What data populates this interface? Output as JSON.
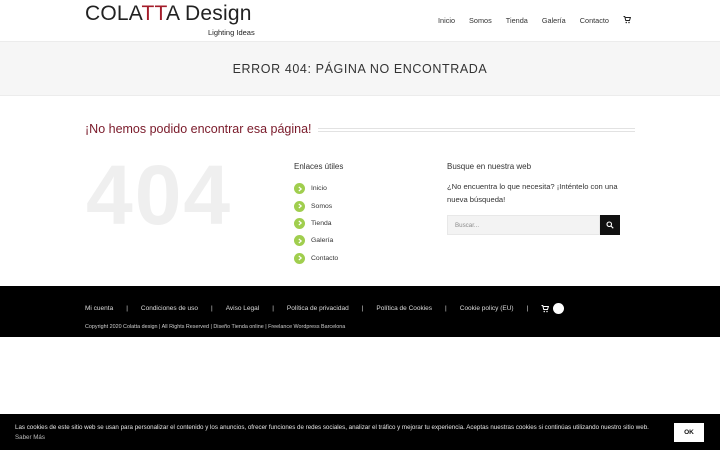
{
  "header": {
    "logo": {
      "part1": "COLA",
      "part2": "TT",
      "part3": "A Design",
      "tagline": "Lighting Ideas"
    },
    "nav": [
      "Inicio",
      "Somos",
      "Tienda",
      "Galería",
      "Contacto"
    ],
    "cart_icon": "shopping-cart-icon"
  },
  "page_title": "ERROR 404: PÁGINA NO ENCONTRADA",
  "main": {
    "heading": "¡No hemos podido encontrar esa página!",
    "big_code": "404",
    "useful_links": {
      "title": "Enlaces útiles",
      "items": [
        "Inicio",
        "Somos",
        "Tienda",
        "Galería",
        "Contacto"
      ],
      "bullet_icon": "chevron-right-icon",
      "bullet_color": "#a0ce4e"
    },
    "search": {
      "title": "Busque en nuestra web",
      "description": "¿No encuentra lo que necesita? ¡Inténtelo con una nueva búsqueda!",
      "placeholder": "Buscar...",
      "button_icon": "search-icon"
    }
  },
  "footer": {
    "links": [
      "Mi cuenta",
      "Condiciones de uso",
      "Aviso Legal",
      "Política de privacidad",
      "Política de Cookies",
      "Cookie policy (EU)"
    ],
    "separator": "|",
    "cart_icon": "shopping-cart-icon",
    "copyright": "Copyright 2020 Colatta design | All Rights Reserved | Diseño Tienda online | Freelance Wordpress Barcelona"
  },
  "cookie": {
    "text": "Las cookies de este sitio web se usan para personalizar el contenido y los anuncios, ofrecer funciones de redes sociales, analizar el tráfico y mejorar tu experiencia. Aceptas nuestras cookies si continúas utilizando nuestro sitio web.",
    "more_link": "Saber Más",
    "ok_label": "OK"
  },
  "colors": {
    "brand_red": "#a31c2a",
    "heading_maroon": "#7a1a2a",
    "accent_green": "#a0ce4e",
    "footer_bg": "#000000"
  }
}
